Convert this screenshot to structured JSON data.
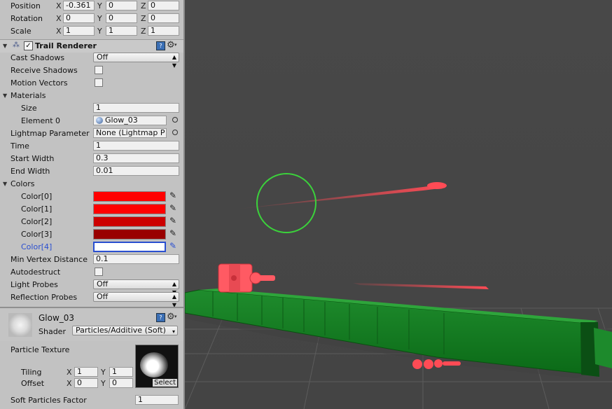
{
  "transform": {
    "position": {
      "label": "Position",
      "x": "-0.361",
      "y": "0",
      "z": "0"
    },
    "rotation": {
      "label": "Rotation",
      "x": "0",
      "y": "0",
      "z": "0"
    },
    "scale": {
      "label": "Scale",
      "x": "1",
      "y": "1",
      "z": "1"
    },
    "axis_x": "X",
    "axis_y": "Y",
    "axis_z": "Z"
  },
  "trail": {
    "title": "Trail Renderer",
    "cast_shadows": {
      "label": "Cast Shadows",
      "value": "Off"
    },
    "receive_shadows": {
      "label": "Receive Shadows"
    },
    "motion_vectors": {
      "label": "Motion Vectors"
    },
    "materials": {
      "label": "Materials",
      "size_label": "Size",
      "size": "1",
      "element_label": "Element 0",
      "element_value": "Glow_03"
    },
    "lightmap": {
      "label": "Lightmap Parameter",
      "value": "None (Lightmap P"
    },
    "time": {
      "label": "Time",
      "value": "1"
    },
    "start_width": {
      "label": "Start Width",
      "value": "0.3"
    },
    "end_width": {
      "label": "End Width",
      "value": "0.01"
    },
    "colors": {
      "label": "Colors",
      "items": [
        {
          "label": "Color[0]",
          "color": "#ff0000"
        },
        {
          "label": "Color[1]",
          "color": "#ff0000"
        },
        {
          "label": "Color[2]",
          "color": "#cc0000"
        },
        {
          "label": "Color[3]",
          "color": "#990000"
        },
        {
          "label": "Color[4]",
          "color": "#ffffff"
        }
      ]
    },
    "min_vertex": {
      "label": "Min Vertex Distance",
      "value": "0.1"
    },
    "autodestruct": {
      "label": "Autodestruct"
    },
    "light_probes": {
      "label": "Light Probes",
      "value": "Off"
    },
    "reflection_probes": {
      "label": "Reflection Probes",
      "value": "Off"
    }
  },
  "material": {
    "name": "Glow_03",
    "shader_label": "Shader",
    "shader_value": "Particles/Additive (Soft)",
    "texture_label": "Particle Texture",
    "tiling_label": "Tiling",
    "tiling_x": "1",
    "tiling_y": "1",
    "offset_label": "Offset",
    "offset_x": "0",
    "offset_y": "0",
    "select_label": "Select",
    "soft_label": "Soft Particles Factor",
    "soft_value": "1"
  }
}
